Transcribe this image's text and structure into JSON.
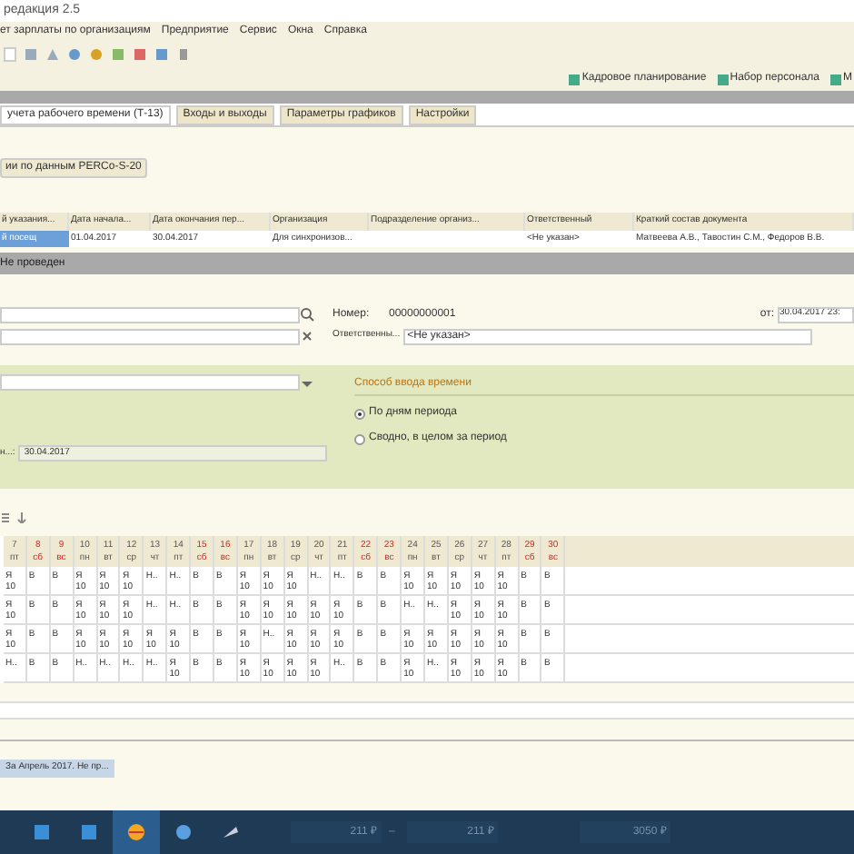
{
  "window": {
    "title": "редакция 2.5"
  },
  "menu": [
    "ет зарплаты по организациям",
    "Предприятие",
    "Сервис",
    "Окна",
    "Справка"
  ],
  "quick_buttons": [
    "Кадровое планирование",
    "Набор персонала",
    "М"
  ],
  "tabs": [
    {
      "label": "учета рабочего времени (Т-13)",
      "selected": true
    },
    {
      "label": "Входы и выходы",
      "selected": false
    },
    {
      "label": "Параметры графиков",
      "selected": false
    },
    {
      "label": "Настройки",
      "selected": false
    }
  ],
  "fill_button": "ии по данным PERCo-S-20",
  "list": {
    "columns": [
      "й указания...",
      "Дата начала...",
      "Дата окончания пер...",
      "Организация",
      "Подразделение организ...",
      "Ответственный",
      "Краткий состав документа"
    ],
    "rows": [
      {
        "selected": true,
        "cells": [
          "й посещ",
          "01.04.2017",
          "30.04.2017",
          "Для синхронизов...",
          "",
          "<Не указан>",
          "Матвеева А.В., Тавостин С.М., Федоров В.В."
        ]
      }
    ]
  },
  "doc_status": "Не проведен",
  "header": {
    "number_label": "Номер:",
    "number": "00000000001",
    "date_label": "от:",
    "date": "30.04.2017 23:",
    "responsible_label": "Ответственны...",
    "responsible": "<Не указан>"
  },
  "settings": {
    "section_title": "Способ ввода времени",
    "options": [
      {
        "label": "По дням периода",
        "selected": true
      },
      {
        "label": "Сводно, в целом за период",
        "selected": false
      }
    ],
    "date_label": "н...:",
    "date": "30.04.2017"
  },
  "days": [
    {
      "day": "7",
      "weekday": "пт",
      "weekend": false
    },
    {
      "day": "8",
      "weekday": "сб",
      "weekend": true
    },
    {
      "day": "9",
      "weekday": "вс",
      "weekend": true
    },
    {
      "day": "10",
      "weekday": "пн",
      "weekend": false
    },
    {
      "day": "11",
      "weekday": "вт",
      "weekend": false
    },
    {
      "day": "12",
      "weekday": "ср",
      "weekend": false
    },
    {
      "day": "13",
      "weekday": "чт",
      "weekend": false
    },
    {
      "day": "14",
      "weekday": "пт",
      "weekend": false
    },
    {
      "day": "15",
      "weekday": "сб",
      "weekend": true
    },
    {
      "day": "16",
      "weekday": "вс",
      "weekend": true
    },
    {
      "day": "17",
      "weekday": "пн",
      "weekend": false
    },
    {
      "day": "18",
      "weekday": "вт",
      "weekend": false
    },
    {
      "day": "19",
      "weekday": "ср",
      "weekend": false
    },
    {
      "day": "20",
      "weekday": "чт",
      "weekend": false
    },
    {
      "day": "21",
      "weekday": "пт",
      "weekend": false
    },
    {
      "day": "22",
      "weekday": "сб",
      "weekend": true
    },
    {
      "day": "23",
      "weekday": "вс",
      "weekend": true
    },
    {
      "day": "24",
      "weekday": "пн",
      "weekend": false
    },
    {
      "day": "25",
      "weekday": "вт",
      "weekend": false
    },
    {
      "day": "26",
      "weekday": "ср",
      "weekend": false
    },
    {
      "day": "27",
      "weekday": "чт",
      "weekend": false
    },
    {
      "day": "28",
      "weekday": "пт",
      "weekend": false
    },
    {
      "day": "29",
      "weekday": "сб",
      "weekend": true
    },
    {
      "day": "30",
      "weekday": "вс",
      "weekend": true
    }
  ],
  "timesheet": [
    [
      "Я 10",
      "В",
      "В",
      "Я 10",
      "Я 10",
      "Я 10",
      "Н..",
      "Н..",
      "В",
      "В",
      "Я 10",
      "Я 10",
      "Я 10",
      "Н..",
      "Н..",
      "В",
      "В",
      "Я 10",
      "Я 10",
      "Я 10",
      "Я 10",
      "Я 10",
      "В",
      "В"
    ],
    [
      "Я 10",
      "В",
      "В",
      "Я 10",
      "Я 10",
      "Я 10",
      "Н..",
      "Н..",
      "В",
      "В",
      "Я 10",
      "Я 10",
      "Я 10",
      "Я 10",
      "Я 10",
      "В",
      "В",
      "Н..",
      "Н..",
      "Я 10",
      "Я 10",
      "Я 10",
      "В",
      "В"
    ],
    [
      "Я 10",
      "В",
      "В",
      "Я 10",
      "Я 10",
      "Я 10",
      "Я 10",
      "Я 10",
      "В",
      "В",
      "Я 10",
      "Н..",
      "Я 10",
      "Я 10",
      "Я 10",
      "В",
      "В",
      "Я 10",
      "Я 10",
      "Я 10",
      "Я 10",
      "Я 10",
      "В",
      "В"
    ],
    [
      "Н..",
      "В",
      "В",
      "Н..",
      "Н..",
      "Н..",
      "Н..",
      "Я 10",
      "В",
      "В",
      "Я 10",
      "Я 10",
      "Я 10",
      "Я 10",
      "Н..",
      "В",
      "В",
      "Я 10",
      "Н..",
      "Я 10",
      "Я 10",
      "Я 10",
      "В",
      "В"
    ]
  ],
  "open_windows": [
    {
      "label": "За Апрель 2017. Не пр...",
      "selected": true
    }
  ],
  "taskbar": {
    "prices": [
      "211 ₽",
      "–",
      "211 ₽",
      "3050 ₽"
    ]
  }
}
